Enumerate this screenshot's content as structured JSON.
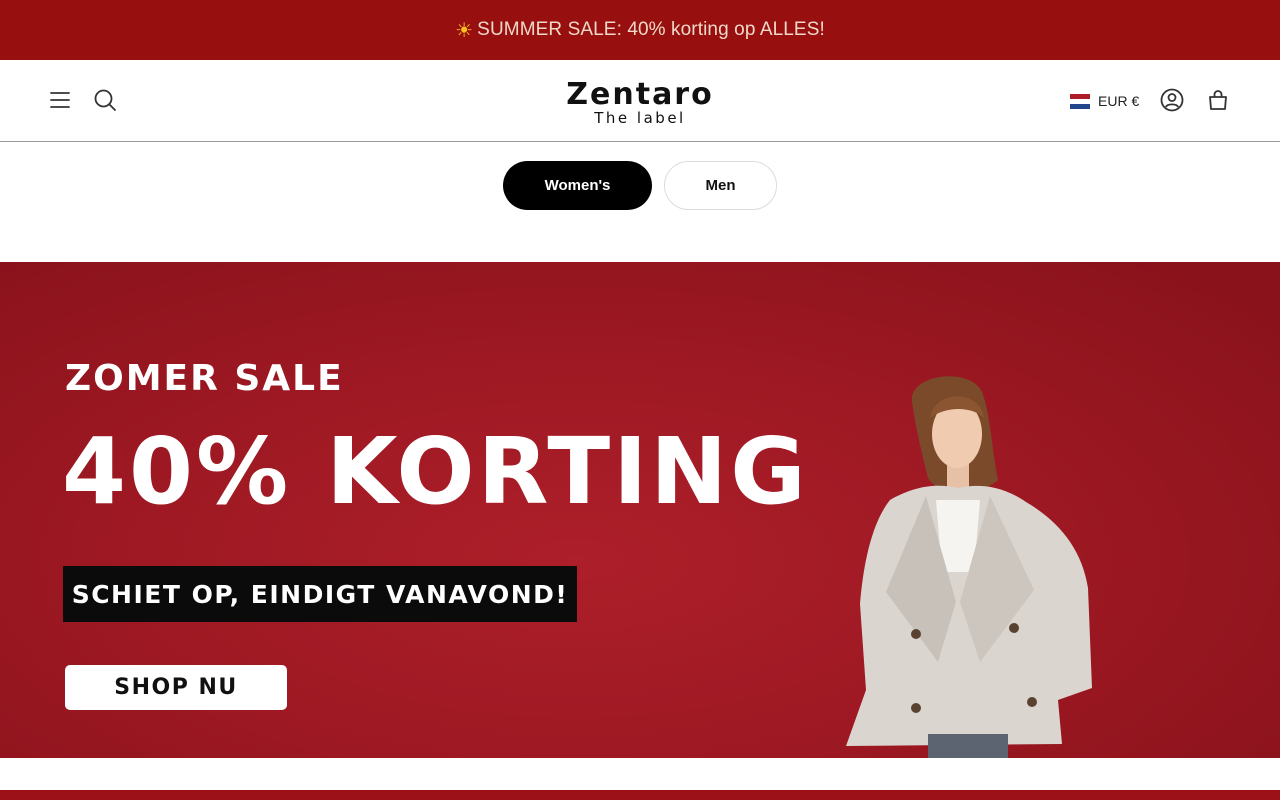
{
  "announcement": {
    "icon": "sun-icon",
    "text": "SUMMER SALE: 40% korting op ALLES!",
    "background": "#970f0f"
  },
  "header": {
    "logo_main": "Zentaro",
    "logo_sub": "The label",
    "currency": "EUR €",
    "icons": [
      "menu-icon",
      "search-icon",
      "account-icon",
      "cart-icon"
    ],
    "flag_colors": [
      "#ae1c28",
      "#ffffff",
      "#21468b"
    ]
  },
  "segments": [
    {
      "label": "Women's",
      "active": true
    },
    {
      "label": "Men",
      "active": false
    }
  ],
  "hero": {
    "kicker": "ZOMER SALE",
    "title": "40% KORTING",
    "strip": "SCHIET OP, EINDIGT VANAVOND!",
    "cta": "SHOP NU",
    "background": "#9c1822"
  }
}
